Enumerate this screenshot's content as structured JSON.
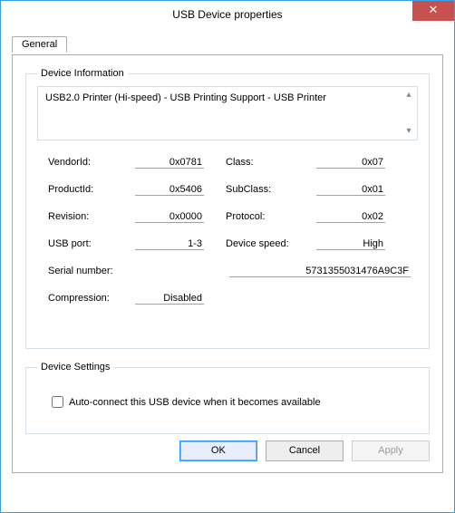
{
  "window": {
    "title": "USB Device properties",
    "close_glyph": "✕"
  },
  "tabs": {
    "general": "General"
  },
  "groups": {
    "device_information": "Device Information",
    "device_settings": "Device Settings"
  },
  "device_description": "USB2.0 Printer (Hi-speed) - USB Printing Support - USB Printer",
  "labels": {
    "vendor_id": "VendorId:",
    "product_id": "ProductId:",
    "revision": "Revision:",
    "usb_port": "USB port:",
    "class": "Class:",
    "subclass": "SubClass:",
    "protocol": "Protocol:",
    "device_speed": "Device speed:",
    "serial_number": "Serial number:",
    "compression": "Compression:"
  },
  "values": {
    "vendor_id": "0x0781",
    "product_id": "0x5406",
    "revision": "0x0000",
    "usb_port": "1-3",
    "class": "0x07",
    "subclass": "0x01",
    "protocol": "0x02",
    "device_speed": "High",
    "serial_number": "5731355031476A9C3F",
    "compression": "Disabled"
  },
  "settings": {
    "auto_connect_label": "Auto-connect this USB device when it becomes available",
    "auto_connect_checked": false
  },
  "buttons": {
    "ok": "OK",
    "cancel": "Cancel",
    "apply": "Apply"
  },
  "scroll": {
    "up": "▴",
    "down": "▾"
  }
}
